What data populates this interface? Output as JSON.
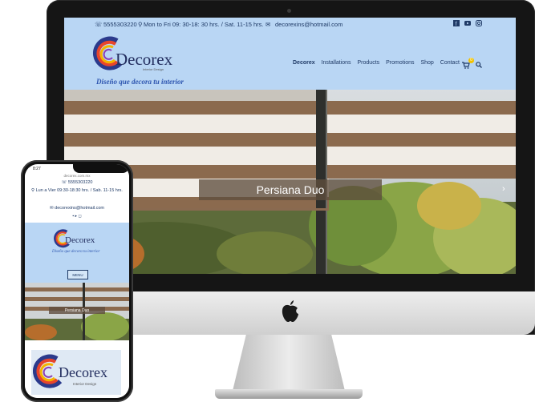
{
  "desktop_site": {
    "topbar": {
      "phone": "5555303220",
      "hours": "Mon to Fri 09: 30-18: 30 hrs. / Sat. 11-15 hrs.",
      "email": "decorexins@hotmail.com"
    },
    "logo": {
      "name": "Decorex",
      "tag": "Interior Design",
      "slogan": "Diseño que decora tu interior"
    },
    "nav": [
      "Decorex",
      "Installations",
      "Products",
      "Promotions",
      "Shop",
      "Contact"
    ],
    "hero_caption": "Persiana Duo",
    "cart_count": "0"
  },
  "mobile_site": {
    "status_time": "8:27",
    "url": "decorex.com.mx",
    "phone": "5555303220",
    "hours": "Lun a Vier 09:30-18:30 hrs. / Sab. 11-15 hrs.",
    "email": "decorexins@hotmail.com",
    "logo_name": "Decorex",
    "logo_slogan": "Diseño que decora tu interior",
    "menu_label": "MENU",
    "hero_caption": "Persiana Duo",
    "footer_logo_name": "Decorex",
    "footer_logo_tag": "Interior Design"
  }
}
